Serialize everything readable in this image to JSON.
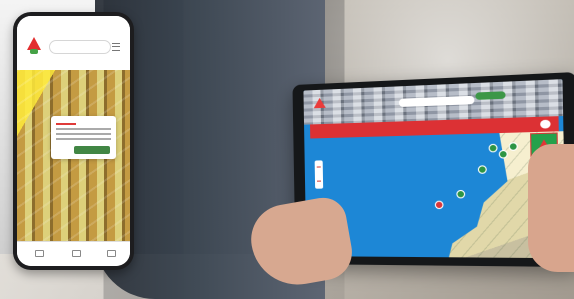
{
  "scene": {
    "description": "",
    "phone": {
      "search_placeholder": ""
    },
    "tablet": {
      "search_placeholder": ""
    }
  }
}
